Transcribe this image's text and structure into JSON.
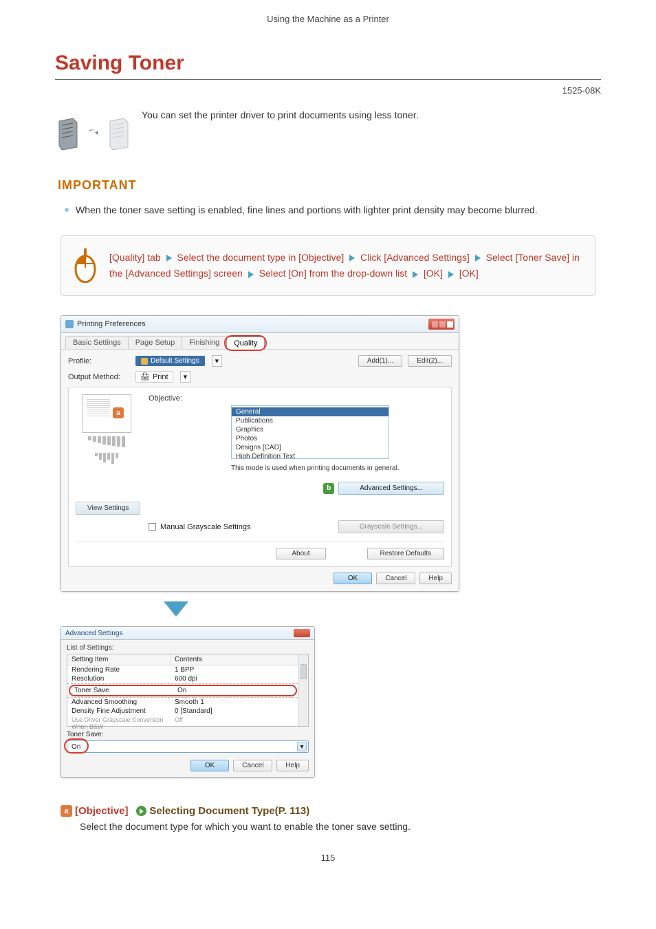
{
  "breadcrumb": "Using the Machine as a Printer",
  "page_title": "Saving Toner",
  "doc_code": "1525-08K",
  "intro_text": "You can set the printer driver to print documents using less toner.",
  "important": {
    "heading": "IMPORTANT",
    "bullet": "When the toner save setting is enabled, fine lines and portions with lighter print density may become blurred."
  },
  "steps": {
    "s1": "[Quality] tab",
    "s2": "Select the document type in [Objective]",
    "s3": "Click [Advanced Settings]",
    "s4": "Select [Toner Save] in the [Advanced Settings] screen",
    "s5": "Select [On] from the drop-down list",
    "s6": "[OK]",
    "s7": "[OK]"
  },
  "pref_dialog": {
    "title": "Printing Preferences",
    "tabs": {
      "t1": "Basic Settings",
      "t2": "Page Setup",
      "t3": "Finishing",
      "t4": "Quality"
    },
    "profile_label": "Profile:",
    "profile_value": "Default Settings",
    "btn_add": "Add(1)...",
    "btn_edit": "Edit(2)...",
    "output_label": "Output Method:",
    "output_value": "Print",
    "objective_label": "Objective:",
    "objective_opts": {
      "o1": "General",
      "o2": "Publications",
      "o3": "Graphics",
      "o4": "Photos",
      "o5": "Designs [CAD]",
      "o6": "High Definition Text"
    },
    "objective_desc": "This mode is used when printing documents in general.",
    "btn_view_settings": "View Settings",
    "btn_advanced": "Advanced Settings...",
    "chk_manual": "Manual Grayscale Settings",
    "btn_grayscale": "Grayscale Settings...",
    "btn_about": "About",
    "btn_restore": "Restore Defaults",
    "btn_ok": "OK",
    "btn_cancel": "Cancel",
    "btn_help": "Help"
  },
  "adv_dialog": {
    "title": "Advanced Settings",
    "list_label": "List of Settings:",
    "col_item": "Setting Item",
    "col_contents": "Contents",
    "rows": {
      "r1i": "Rendering Rate",
      "r1c": "1 BPP",
      "r2i": "Resolution",
      "r2c": "600 dpi",
      "r3i": "Toner Save",
      "r3c": "On",
      "r4i": "Advanced Smoothing",
      "r4c": "Smooth 1",
      "r5i": "Density Fine Adjustment",
      "r5c": "0 [Standard]",
      "r6i": "Use Driver Grayscale Conversion When B&W",
      "r6c": "Off"
    },
    "toner_save_label": "Toner Save:",
    "toner_save_value": "On",
    "btn_ok": "OK",
    "btn_cancel": "Cancel",
    "btn_help": "Help"
  },
  "link_section": {
    "label": "[Objective]",
    "link_text": "Selecting Document Type(P. 113)",
    "desc": "Select the document type for which you want to enable the toner save setting."
  },
  "page_number": "115"
}
